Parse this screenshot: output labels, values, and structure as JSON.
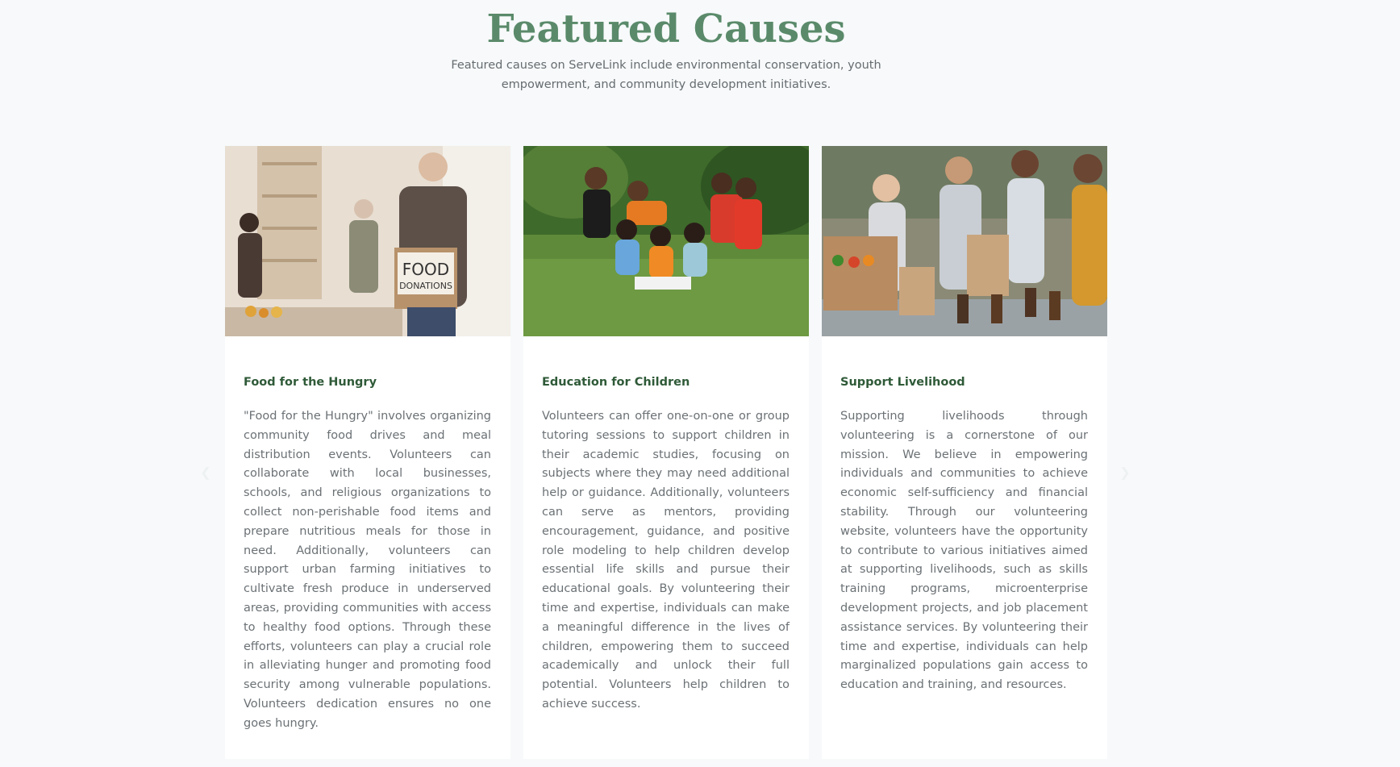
{
  "header": {
    "title": "Featured Causes",
    "subtitle": "Featured causes on ServeLink include environmental conservation, youth empowerment, and community development initiatives."
  },
  "carousel": {
    "prev_icon": "chevron-left-icon",
    "next_icon": "chevron-right-icon"
  },
  "causes": [
    {
      "title": "Food for the Hungry",
      "image_box_line1": "FOOD",
      "image_box_line2": "DONATIONS",
      "description": "\"Food for the Hungry\" involves organizing community food drives and meal distribution events. Volunteers can collaborate with local businesses, schools, and religious organizations to collect non-perishable food items and prepare nutritious meals for those in need. Additionally, volunteers can support urban farming initiatives to cultivate fresh produce in underserved areas, providing communities with access to healthy food options. Through these efforts, volunteers can play a crucial role in alleviating hunger and promoting food security among vulnerable populations. Volunteers dedication ensures no one goes hungry."
    },
    {
      "title": "Education for Children",
      "description": "Volunteers can offer one-on-one or group tutoring sessions to support children in their academic studies, focusing on subjects where they may need additional help or guidance. Additionally, volunteers can serve as mentors, providing encouragement, guidance, and positive role modeling to help children develop essential life skills and pursue their educational goals. By volunteering their time and expertise, individuals can make a meaningful difference in the lives of children, empowering them to succeed academically and unlock their full potential. Volunteers help children to achieve success."
    },
    {
      "title": "Support Livelihood",
      "description": "Supporting livelihoods through volunteering is a cornerstone of our mission. We believe in empowering individuals and communities to achieve economic self-sufficiency and financial stability. Through our volunteering website, volunteers have the opportunity to contribute to various initiatives aimed at supporting livelihoods, such as skills training programs, microenterprise development projects, and job placement assistance services. By volunteering their time and expertise, individuals can help marginalized populations gain access to education and training, and resources."
    }
  ],
  "colors": {
    "title": "#5a8a6a",
    "card_title": "#2f5a38",
    "body_text": "#6b7175",
    "background": "#f7f9fa"
  }
}
